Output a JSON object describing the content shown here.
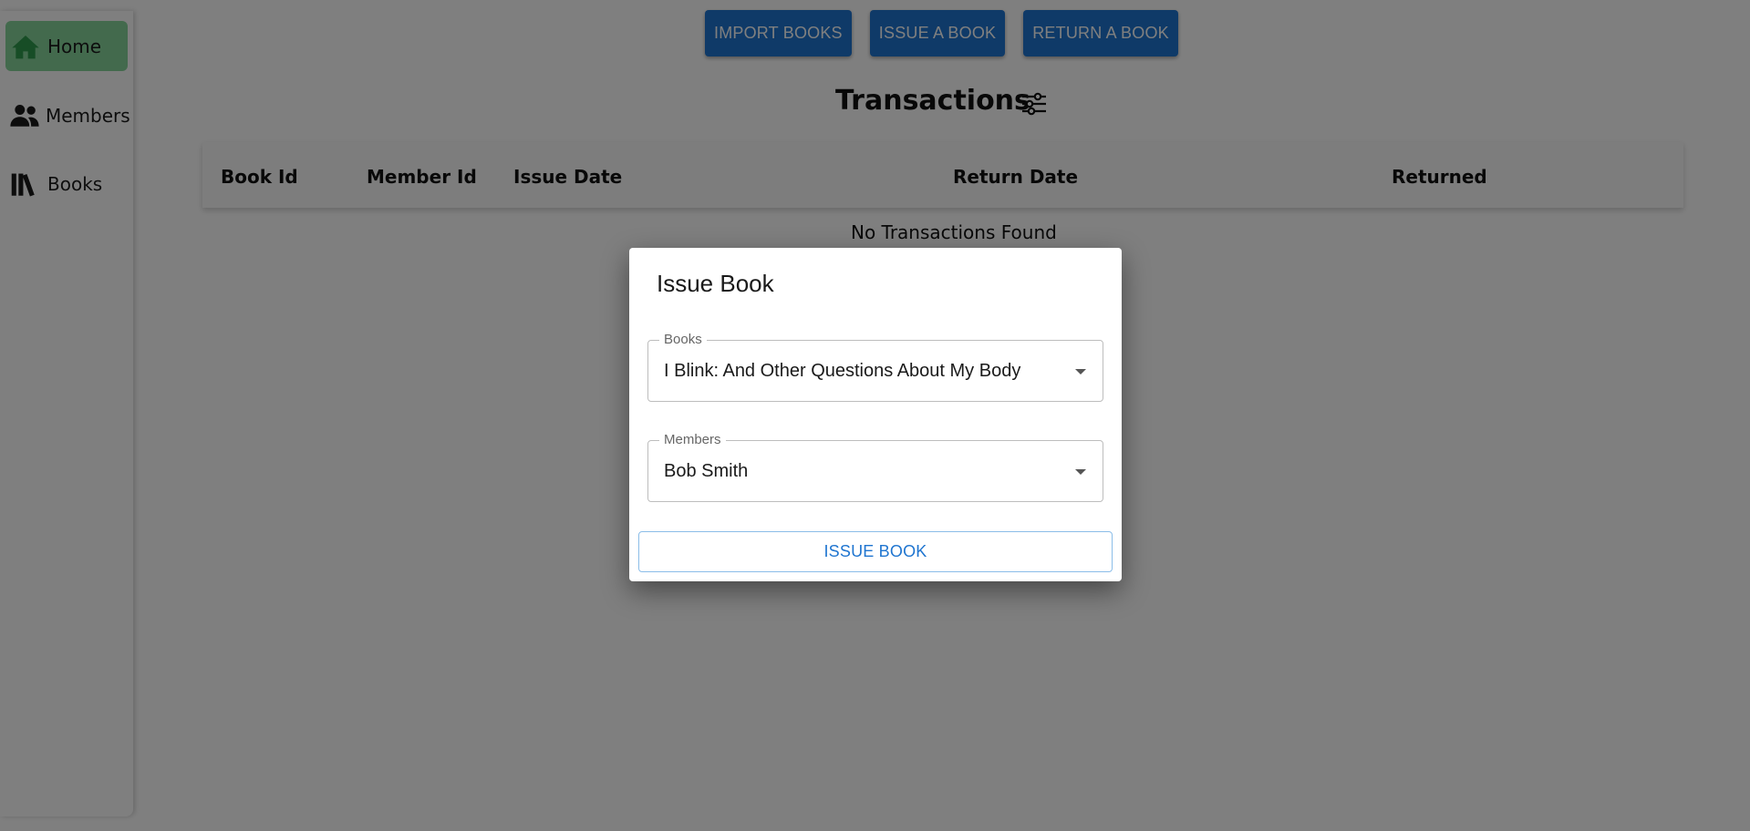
{
  "sidebar": {
    "items": [
      {
        "label": "Home",
        "icon": "home-icon",
        "active": true
      },
      {
        "label": "Members",
        "icon": "people-icon",
        "active": false
      },
      {
        "label": "Books",
        "icon": "books-icon",
        "active": false
      }
    ]
  },
  "toolbar": {
    "import_label": "IMPORT BOOKS",
    "issue_label": "ISSUE A BOOK",
    "return_label": "RETURN A BOOK"
  },
  "transactions": {
    "title": "Transactions",
    "filter_icon": "sliders-icon",
    "columns": [
      "Book Id",
      "Member Id",
      "Issue Date",
      "Return Date",
      "Returned"
    ],
    "empty_text": "No Transactions Found"
  },
  "dialog": {
    "title": "Issue Book",
    "books_label": "Books",
    "books_value": "I Blink: And Other Questions About My Body",
    "members_label": "Members",
    "members_value": "Bob Smith",
    "submit_label": "ISSUE BOOK"
  },
  "colors": {
    "primary": "#1f75d0",
    "active_nav": "#86d49a",
    "backdrop": "rgba(0,0,0,0.5)"
  }
}
